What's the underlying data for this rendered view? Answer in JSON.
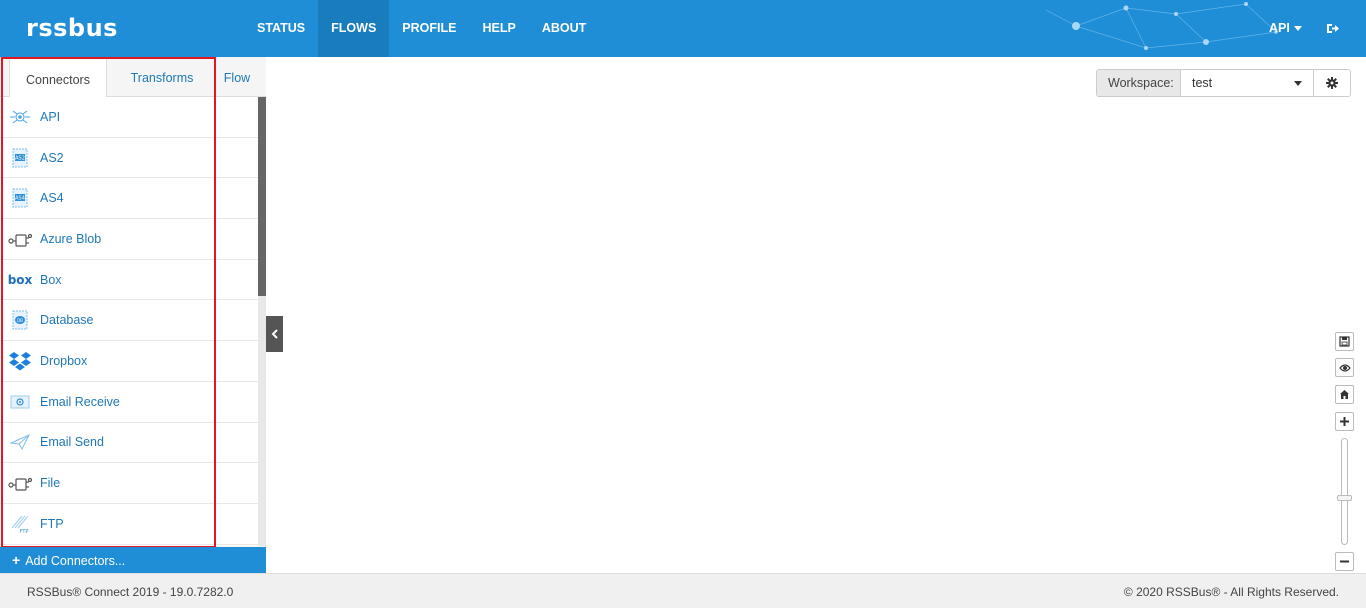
{
  "header": {
    "logo": "rssbus",
    "nav": [
      {
        "label": "STATUS",
        "active": false
      },
      {
        "label": "FLOWS",
        "active": true
      },
      {
        "label": "PROFILE",
        "active": false
      },
      {
        "label": "HELP",
        "active": false
      },
      {
        "label": "ABOUT",
        "active": false
      }
    ],
    "user_menu": "API",
    "logout_icon": "sign-out-icon"
  },
  "sidebar": {
    "tabs": [
      {
        "label": "Connectors",
        "active": true
      },
      {
        "label": "Transforms",
        "active": false
      },
      {
        "label": "Flow",
        "active": false
      }
    ],
    "items": [
      {
        "label": "API",
        "icon": "api-gear-icon"
      },
      {
        "label": "AS2",
        "icon": "as2-document-icon"
      },
      {
        "label": "AS4",
        "icon": "as4-document-icon"
      },
      {
        "label": "Azure Blob",
        "icon": "plug-connector-icon"
      },
      {
        "label": "Box",
        "icon": "box-logo-icon"
      },
      {
        "label": "Database",
        "icon": "database-icon"
      },
      {
        "label": "Dropbox",
        "icon": "dropbox-logo-icon"
      },
      {
        "label": "Email Receive",
        "icon": "email-receive-icon"
      },
      {
        "label": "Email Send",
        "icon": "paper-plane-icon"
      },
      {
        "label": "File",
        "icon": "plug-connector-icon"
      },
      {
        "label": "FTP",
        "icon": "ftp-icon"
      }
    ],
    "add_button": "Add Connectors..."
  },
  "workspace": {
    "label": "Workspace:",
    "value": "test"
  },
  "footer": {
    "left": "RSSBus® Connect 2019 - 19.0.7282.0",
    "right": "© 2020 RSSBus® - All Rights Reserved."
  },
  "colors": {
    "header": "#1f8ed6",
    "link": "#1f78b8",
    "highlight": "#e5161e"
  }
}
